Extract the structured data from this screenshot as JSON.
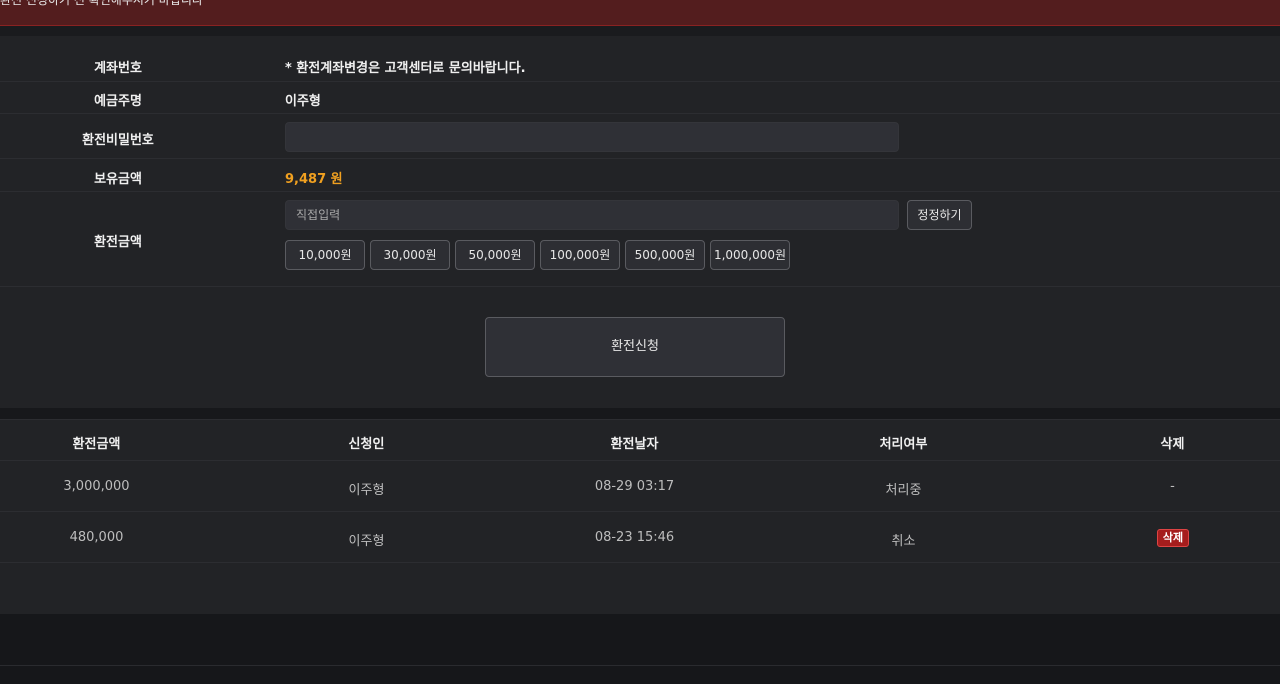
{
  "banner": {
    "text": "환전 신청하기 전 확인해주시기 바랍니다"
  },
  "form": {
    "account_label": "계좌번호",
    "account_value": "* 환전계좌변경은 고객센터로 문의바랍니다.",
    "holder_label": "예금주명",
    "holder_value": "이주형",
    "password_label": "환전비밀번호",
    "password_value": "",
    "balance_label": "보유금액",
    "balance_value": "9,487 원",
    "amount_label": "환전금액",
    "amount_placeholder": "직접입력",
    "reset_label": "정정하기",
    "quick_amounts": [
      "10,000원",
      "30,000원",
      "50,000원",
      "100,000원",
      "500,000원",
      "1,000,000원"
    ],
    "submit_label": "환전신청"
  },
  "history": {
    "headers": [
      "환전금액",
      "신청인",
      "환전날자",
      "처리여부",
      "삭제"
    ],
    "rows": [
      {
        "amount": "3,000,000",
        "applicant": "이주형",
        "date": "08-29 03:17",
        "status": "처리중",
        "delete": "-"
      },
      {
        "amount": "480,000",
        "applicant": "이주형",
        "date": "08-23 15:46",
        "status": "취소",
        "delete": "삭제"
      }
    ]
  },
  "colors": {
    "accent": "#f0a020",
    "banner": "#531d1e",
    "delete_badge": "#a51d1d"
  }
}
